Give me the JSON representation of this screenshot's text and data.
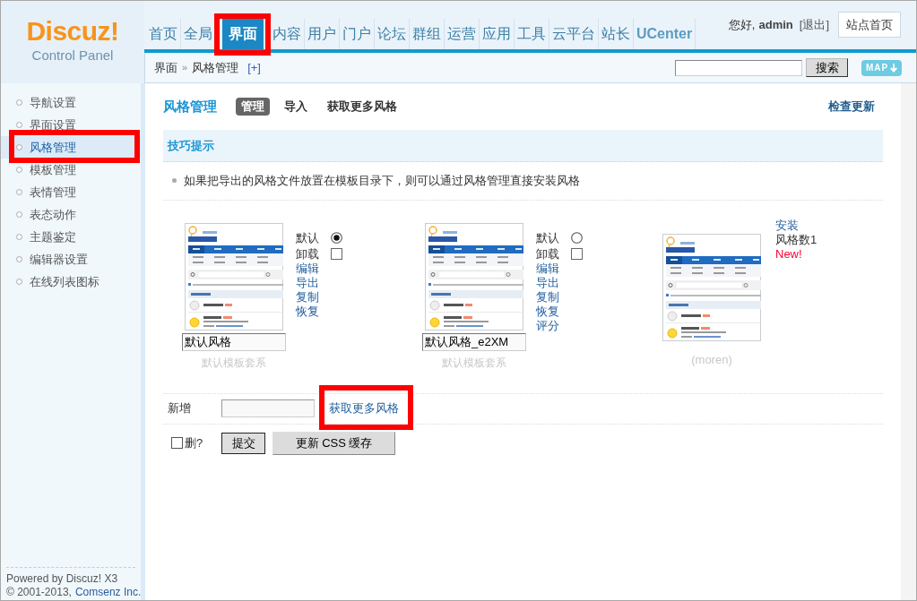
{
  "header": {
    "logo": {
      "name": "Discuz!",
      "subtitle": "Control Panel"
    },
    "nav": [
      {
        "label": "首页",
        "kind": "module",
        "selected": false,
        "highlighted": false
      },
      {
        "label": "全局",
        "kind": "module",
        "selected": false,
        "highlighted": false
      },
      {
        "label": "界面",
        "kind": "module",
        "selected": true,
        "highlighted": true
      },
      {
        "label": "内容",
        "kind": "module",
        "selected": false,
        "highlighted": false
      },
      {
        "label": "用户",
        "kind": "module",
        "selected": false,
        "highlighted": false
      },
      {
        "label": "门户",
        "kind": "module",
        "selected": false,
        "highlighted": false
      },
      {
        "label": "论坛",
        "kind": "module",
        "selected": false,
        "highlighted": false
      },
      {
        "label": "群组",
        "kind": "module",
        "selected": false,
        "highlighted": false
      },
      {
        "label": "运营",
        "kind": "module",
        "selected": false,
        "highlighted": false
      },
      {
        "label": "应用",
        "kind": "module",
        "selected": false,
        "highlighted": false
      },
      {
        "label": "工具",
        "kind": "module",
        "selected": false,
        "highlighted": false
      },
      {
        "label": "云平台",
        "kind": "module",
        "selected": false,
        "highlighted": false
      },
      {
        "label": "站长",
        "kind": "module",
        "selected": false,
        "highlighted": false
      },
      {
        "label": "UCenter",
        "kind": "app",
        "selected": false,
        "highlighted": false
      }
    ],
    "user": {
      "greeting": "您好,",
      "name": "admin",
      "logout": "[退出]"
    },
    "home_button": "站点首页"
  },
  "toolbar": {
    "breadcrumb": [
      {
        "label": "界面"
      },
      {
        "label": "风格管理"
      }
    ],
    "separator": "»",
    "add_shortcut": "[+]",
    "search_button": "搜索",
    "map_button": "MAP"
  },
  "sidebar": {
    "items": [
      {
        "label": "导航设置",
        "selected": false,
        "highlighted": false
      },
      {
        "label": "界面设置",
        "selected": false,
        "highlighted": false
      },
      {
        "label": "风格管理",
        "selected": true,
        "highlighted": true
      },
      {
        "label": "模板管理",
        "selected": false,
        "highlighted": false
      },
      {
        "label": "表情管理",
        "selected": false,
        "highlighted": false
      },
      {
        "label": "表态动作",
        "selected": false,
        "highlighted": false
      },
      {
        "label": "主题鉴定",
        "selected": false,
        "highlighted": false
      },
      {
        "label": "编辑器设置",
        "selected": false,
        "highlighted": false
      },
      {
        "label": "在线列表图标",
        "selected": false,
        "highlighted": false
      }
    ],
    "footer": {
      "powered": "Powered by Discuz! X3",
      "copyright": "© 2001-2013,",
      "company": "Comsenz Inc."
    }
  },
  "page": {
    "title": "风格管理",
    "tabs": [
      {
        "label": "管理",
        "selected": true
      },
      {
        "label": "导入",
        "selected": false
      },
      {
        "label": "获取更多风格",
        "selected": false
      }
    ],
    "check_update": "检查更新",
    "tips": {
      "title": "技巧提示",
      "items": [
        "如果把导出的风格文件放置在模板目录下，则可以通过风格管理直接安装风格"
      ]
    },
    "styles": [
      {
        "kind": "installed",
        "name": "默认风格",
        "template": "默认模板套系",
        "default_label": "默认",
        "default": true,
        "uninstall_label": "卸载",
        "uninstall": false,
        "actions": [
          "编辑",
          "导出",
          "复制",
          "恢复"
        ]
      },
      {
        "kind": "installed",
        "name": "默认风格_e2XM",
        "template": "默认模板套系",
        "default_label": "默认",
        "default": false,
        "uninstall_label": "卸载",
        "uninstall": false,
        "actions": [
          "编辑",
          "导出",
          "复制",
          "恢复",
          "评分"
        ]
      },
      {
        "kind": "available",
        "caption": "(moren)",
        "actions": [
          "安装"
        ],
        "count": "风格数1",
        "badge": "New!"
      }
    ],
    "new_style": {
      "label": "新增",
      "link": {
        "label": "获取更多风格",
        "highlighted": true
      }
    },
    "delete": {
      "label": "删?",
      "checked": false
    },
    "buttons": [
      {
        "label": "提交",
        "kind": "submit"
      },
      {
        "label": "更新 CSS 缓存",
        "kind": "action"
      }
    ]
  }
}
